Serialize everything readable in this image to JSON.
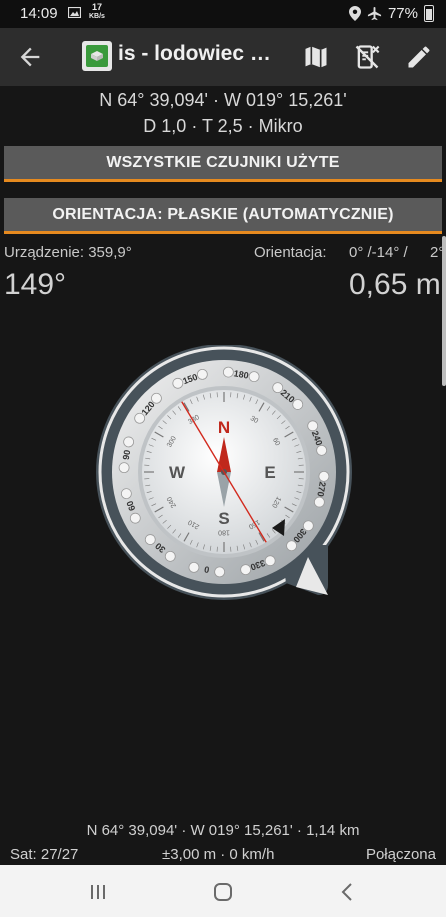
{
  "status_bar": {
    "time": "14:09",
    "net_speed_value": "17",
    "net_speed_unit": "KB/s",
    "battery": "77%",
    "icons": [
      "image-icon",
      "location-icon",
      "airplane-icon",
      "battery-icon"
    ]
  },
  "app_bar": {
    "title": "is - lodowiec s…",
    "actions": [
      "back-arrow-icon",
      "map-icon",
      "sensor-off-icon",
      "edit-pencil-icon"
    ]
  },
  "cache": {
    "coords": "N 64° 39,094' · W 019° 15,261'",
    "details": "D 1,0 · T 2,5 · Mikro"
  },
  "buttons": {
    "sensors": "WSZYSTKIE CZUJNIKI UŻYTE",
    "orientation": "ORIENTACJA: PŁASKIE (AUTOMATYCZNIE)"
  },
  "readout": {
    "device_label": "Urządzenie: 359,9°",
    "orientation_label": "Orientacja:",
    "orientation_value": "0° /-14° /",
    "orientation_extra": "2°",
    "bearing": "149°",
    "distance": "0,65 m"
  },
  "compass": {
    "cardinals": {
      "N": "N",
      "E": "E",
      "S": "S",
      "W": "W"
    },
    "outer_ticks": [
      "0",
      "30",
      "60",
      "90",
      "120",
      "150",
      "180",
      "210",
      "240",
      "270",
      "300",
      "330"
    ],
    "inner_ticks": [
      "30",
      "60",
      "120",
      "150",
      "210",
      "240",
      "300",
      "330",
      "180"
    ],
    "bearing_degrees": 149
  },
  "footer": {
    "coords": "N 64° 39,094' · W 019° 15,261' · 1,14 km",
    "sat": "Sat: 27/27",
    "accuracy": "±3,00 m · 0 km/h",
    "connection": "Połączona"
  },
  "colors": {
    "accent": "#e68a1f",
    "app_bar": "#2d2d2d",
    "background": "#161616",
    "button": "#5a5a5a",
    "needle_north": "#c0281c"
  }
}
